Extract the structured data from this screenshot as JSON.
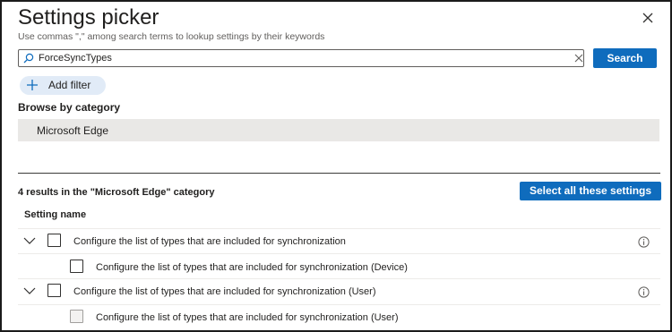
{
  "dialog": {
    "title": "Settings picker",
    "subtitle": "Use commas \",\" among search terms to lookup settings by their keywords",
    "close_icon": "close-icon"
  },
  "search": {
    "value": "ForceSyncTypes",
    "placeholder": "",
    "button_label": "Search",
    "icon": "search-icon",
    "clear_icon": "clear-icon"
  },
  "filter": {
    "add_filter_label": "Add filter",
    "icon": "plus-icon"
  },
  "browse": {
    "label": "Browse by category",
    "selected_category": "Microsoft Edge"
  },
  "results": {
    "summary": "4 results in the \"Microsoft Edge\" category",
    "select_all_label": "Select all these settings",
    "column_header": "Setting name",
    "rows": [
      {
        "label": "Configure the list of types that are included for synchronization",
        "expandable": true,
        "level": 0,
        "info": true,
        "checked": false
      },
      {
        "label": "Configure the list of types that are included for synchronization (Device)",
        "expandable": false,
        "level": 1,
        "info": false,
        "checked": false
      },
      {
        "label": "Configure the list of types that are included for synchronization (User)",
        "expandable": true,
        "level": 0,
        "info": true,
        "checked": false
      },
      {
        "label": "Configure the list of types that are included for synchronization (User)",
        "expandable": false,
        "level": 1,
        "info": false,
        "checked": false,
        "disabled": true
      }
    ]
  },
  "colors": {
    "primary": "#0f6cbd",
    "pill": "#e1ebf7",
    "category_bg": "#e9e8e6"
  }
}
